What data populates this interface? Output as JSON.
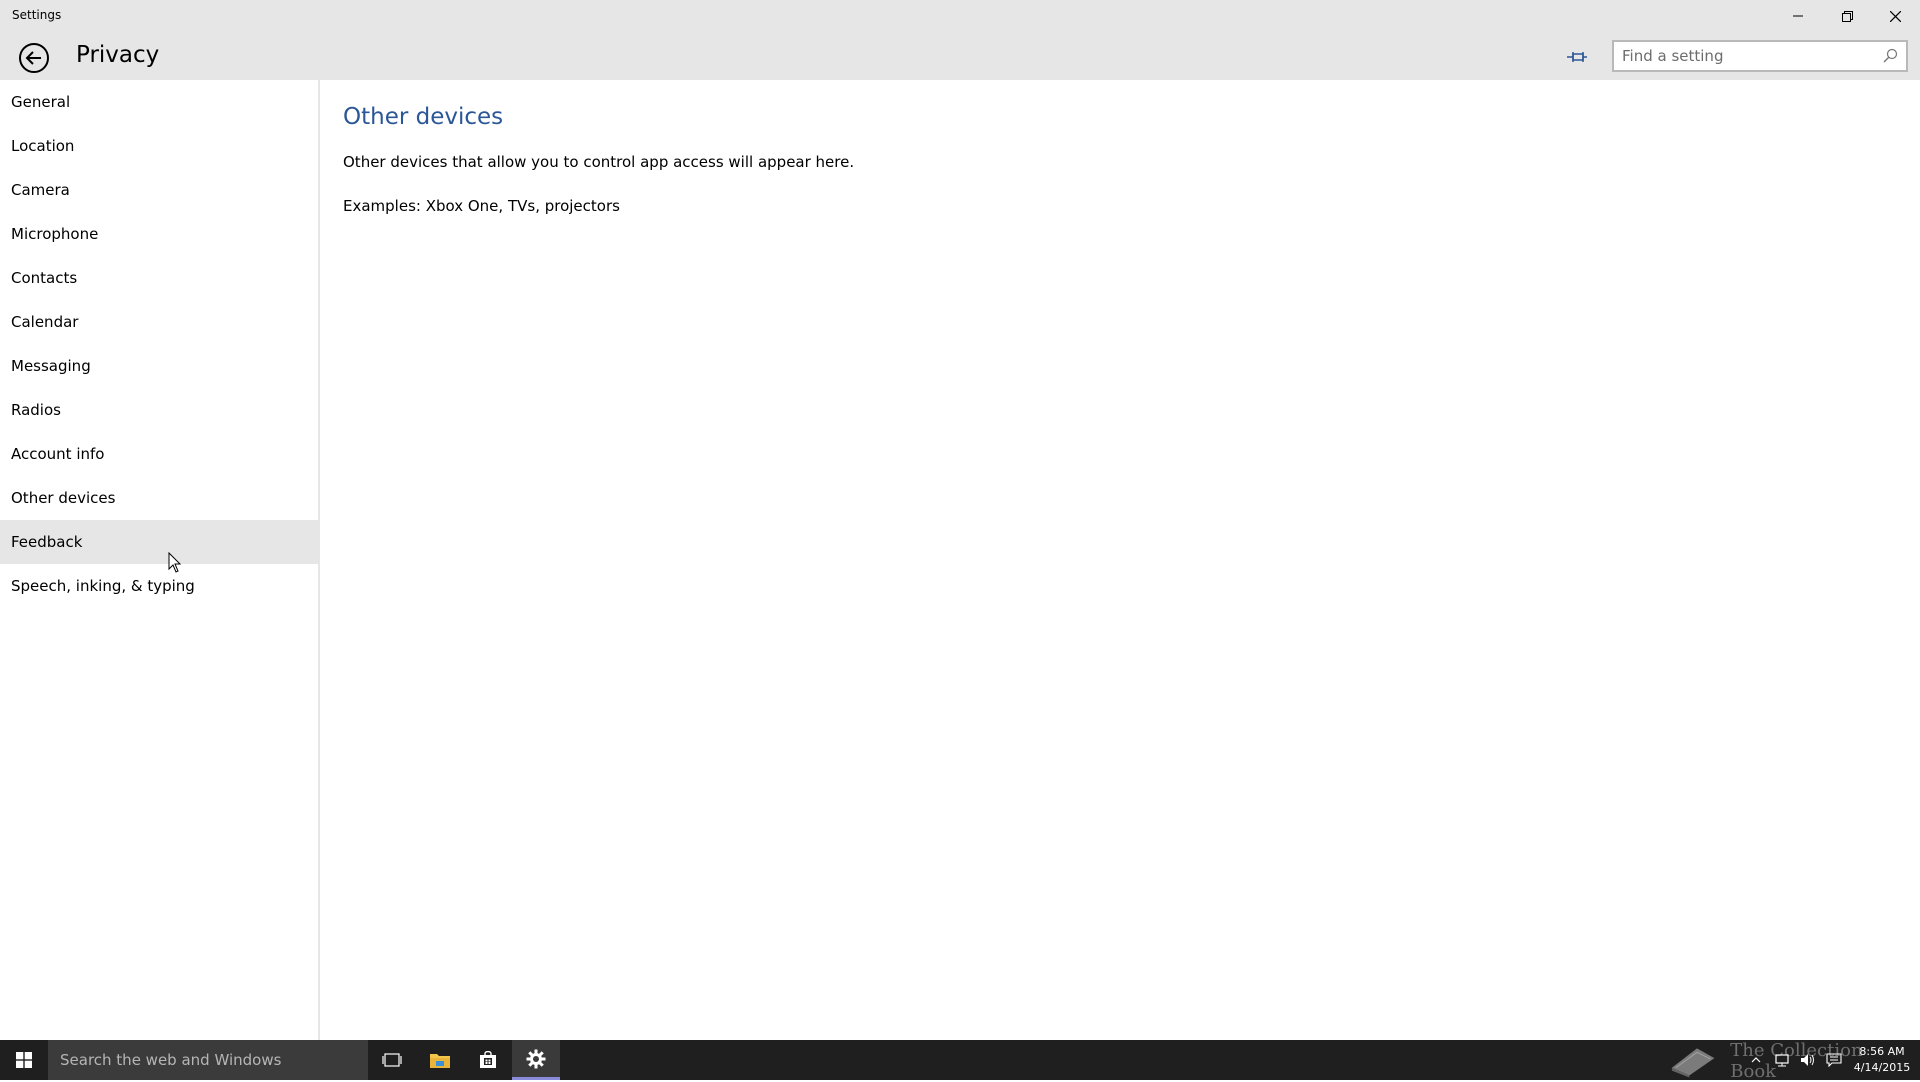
{
  "window": {
    "title": "Settings"
  },
  "header": {
    "title": "Privacy",
    "search_placeholder": "Find a setting"
  },
  "sidebar": {
    "items": [
      {
        "label": "General"
      },
      {
        "label": "Location"
      },
      {
        "label": "Camera"
      },
      {
        "label": "Microphone"
      },
      {
        "label": "Contacts"
      },
      {
        "label": "Calendar"
      },
      {
        "label": "Messaging"
      },
      {
        "label": "Radios"
      },
      {
        "label": "Account info"
      },
      {
        "label": "Other devices"
      },
      {
        "label": "Feedback"
      },
      {
        "label": "Speech, inking, & typing"
      }
    ],
    "hovered_item": "Feedback"
  },
  "content": {
    "title": "Other devices",
    "description": "Other devices that allow you to control app access will appear here.",
    "examples": "Examples: Xbox One, TVs, projectors"
  },
  "taskbar": {
    "search_placeholder": "Search the web and Windows",
    "watermark": "The Collection Book",
    "time": "8:56 AM",
    "date": "4/14/2015"
  },
  "colors": {
    "accent": "#2b5797",
    "chrome": "#e6e6e6",
    "taskbar": "#1f1f1f"
  },
  "icons": {
    "back": "back-arrow-icon",
    "pin": "pin-icon",
    "search": "search-icon",
    "minimize": "minimize-icon",
    "restore": "restore-icon",
    "close": "close-icon"
  }
}
